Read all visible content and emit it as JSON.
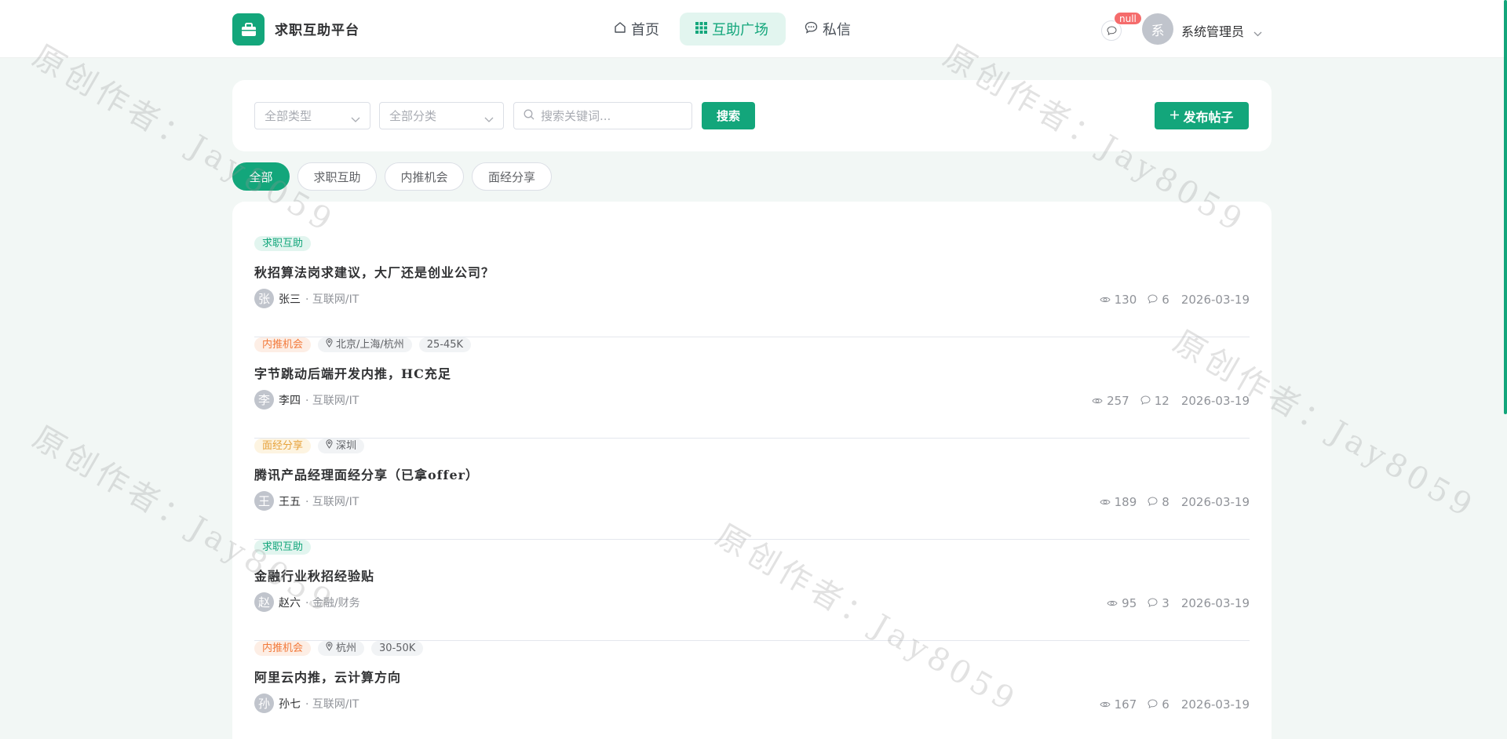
{
  "brand": {
    "name": "求职互助平台"
  },
  "nav": {
    "items": [
      {
        "label": "首页"
      },
      {
        "label": "互助广场"
      },
      {
        "label": "私信"
      }
    ]
  },
  "user": {
    "avatar_char": "系",
    "name": "系统管理员",
    "notice_badge": "null"
  },
  "filters": {
    "type_select": "全部类型",
    "category_select": "全部分类",
    "search_placeholder": "搜索关键词...",
    "search_button": "搜索",
    "publish_button": "发布帖子"
  },
  "chips": [
    {
      "label": "全部"
    },
    {
      "label": "求职互助"
    },
    {
      "label": "内推机会"
    },
    {
      "label": "面经分享"
    }
  ],
  "posts": [
    {
      "category": "求职互助",
      "title": "秋招算法岗求建议，大厂还是创业公司？",
      "avatar": "张",
      "author": "张三",
      "industry": "· 互联网/IT",
      "views": "130",
      "comments": "6",
      "date": "2026-03-19"
    },
    {
      "category": "内推机会",
      "location": "北京/上海/杭州",
      "salary": "25-45K",
      "title": "字节跳动后端开发内推，HC充足",
      "avatar": "李",
      "author": "李四",
      "industry": "· 互联网/IT",
      "views": "257",
      "comments": "12",
      "date": "2026-03-19"
    },
    {
      "category": "面经分享",
      "location": "深圳",
      "title": "腾讯产品经理面经分享（已拿offer）",
      "avatar": "王",
      "author": "王五",
      "industry": "· 互联网/IT",
      "views": "189",
      "comments": "8",
      "date": "2026-03-19"
    },
    {
      "category": "求职互助",
      "title": "金融行业秋招经验贴",
      "avatar": "赵",
      "author": "赵六",
      "industry": "· 金融/财务",
      "views": "95",
      "comments": "3",
      "date": "2026-03-19"
    },
    {
      "category": "内推机会",
      "location": "杭州",
      "salary": "30-50K",
      "title": "阿里云内推，云计算方向",
      "avatar": "孙",
      "author": "孙七",
      "industry": "· 互联网/IT",
      "views": "167",
      "comments": "6",
      "date": "2026-03-19"
    }
  ],
  "watermark": {
    "text": "原创作者：Jay8059"
  },
  "colors": {
    "accent": "#13a67b",
    "refer": "#f27a3b",
    "interview": "#e6a23c",
    "badge": "#f56c6c"
  }
}
